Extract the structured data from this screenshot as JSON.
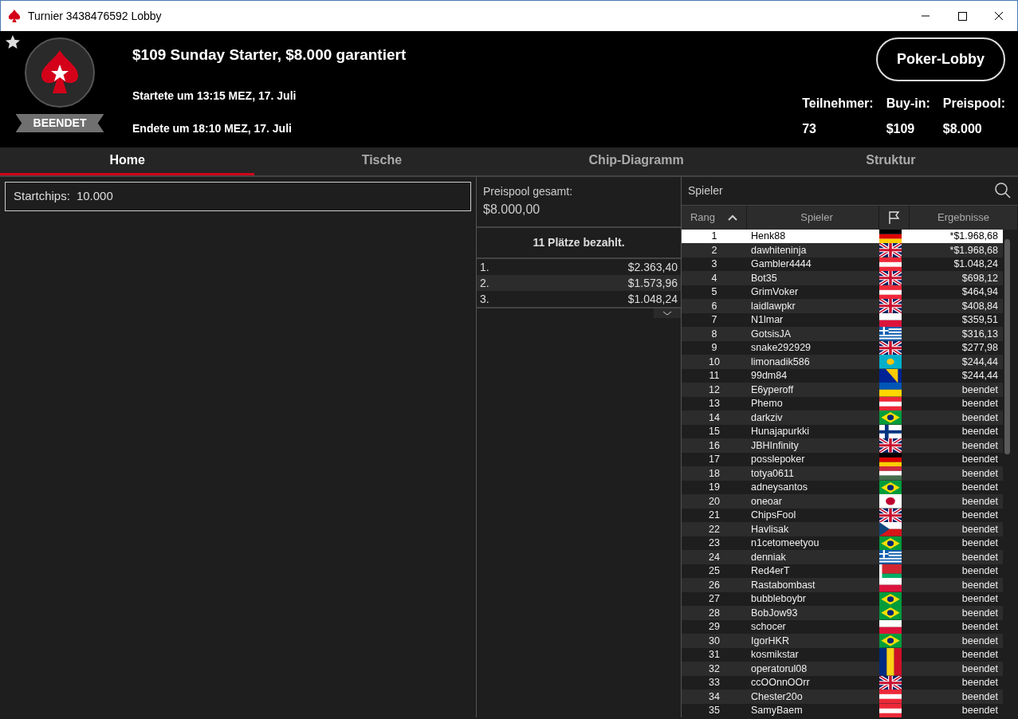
{
  "window": {
    "title": "Turnier 3438476592 Lobby"
  },
  "header": {
    "badge": "BEENDET",
    "title": "$109 Sunday Starter, $8.000 garantiert",
    "started": "Startete um 13:15 MEZ, 17. Juli",
    "ended": "Endete um 18:10 MEZ, 17. Juli",
    "lobby_button": "Poker-Lobby",
    "stats": [
      {
        "label": "Teilnehmer:",
        "value": "73"
      },
      {
        "label": "Buy-in:",
        "value": "$109"
      },
      {
        "label": "Preispool:",
        "value": "$8.000"
      }
    ]
  },
  "tabs": [
    {
      "label": "Home",
      "selected": true
    },
    {
      "label": "Tische",
      "selected": false
    },
    {
      "label": "Chip-Diagramm",
      "selected": false
    },
    {
      "label": "Struktur",
      "selected": false
    }
  ],
  "info": {
    "startchips_label": "Startchips:",
    "startchips": "10.000"
  },
  "prizes": {
    "pool_label": "Preispool gesamt:",
    "pool": "$8.000,00",
    "paid": "11 Plätze bezahlt.",
    "rows": [
      {
        "place": "1.",
        "amount": "$2.363,40"
      },
      {
        "place": "2.",
        "amount": "$1.573,96"
      },
      {
        "place": "3.",
        "amount": "$1.048,24"
      }
    ]
  },
  "players": {
    "search_label": "Spieler",
    "columns": [
      "Rang",
      "Spieler",
      "Ergebnisse"
    ],
    "rows": [
      {
        "rank": "1",
        "name": "Henk88",
        "kind": "de",
        "result": "*$1.968,68",
        "selected": true
      },
      {
        "rank": "2",
        "name": "dawhiteninja",
        "kind": "gb",
        "result": "*$1.968,68",
        "selected": false
      },
      {
        "rank": "3",
        "name": "Gambler4444",
        "kind": "at",
        "result": "$1.048,24",
        "selected": false
      },
      {
        "rank": "4",
        "name": "Bot35",
        "kind": "gb",
        "result": "$698,12",
        "selected": false
      },
      {
        "rank": "5",
        "name": "GrimVoker",
        "kind": "at",
        "result": "$464,94",
        "selected": false
      },
      {
        "rank": "6",
        "name": "laidlawpkr",
        "kind": "gb",
        "result": "$408,84",
        "selected": false
      },
      {
        "rank": "7",
        "name": "N1lmar",
        "kind": "pl",
        "result": "$359,51",
        "selected": false
      },
      {
        "rank": "8",
        "name": "GotsisJA",
        "kind": "gr",
        "result": "$316,13",
        "selected": false
      },
      {
        "rank": "9",
        "name": "snake292929",
        "kind": "gb",
        "result": "$277,98",
        "selected": false
      },
      {
        "rank": "10",
        "name": "limonadik586",
        "kind": "kz",
        "result": "$244,44",
        "selected": false
      },
      {
        "rank": "11",
        "name": "99dm84",
        "kind": "ba",
        "result": "$244,44",
        "selected": false
      },
      {
        "rank": "12",
        "name": "E6yperoff",
        "kind": "ua",
        "result": "beendet",
        "selected": false
      },
      {
        "rank": "13",
        "name": "Phemo",
        "kind": "at",
        "result": "beendet",
        "selected": false
      },
      {
        "rank": "14",
        "name": "darkziv",
        "kind": "br",
        "result": "beendet",
        "selected": false
      },
      {
        "rank": "15",
        "name": "Hunajapurkki",
        "kind": "fi",
        "result": "beendet",
        "selected": false
      },
      {
        "rank": "16",
        "name": "JBHInfinity",
        "kind": "gb",
        "result": "beendet",
        "selected": false
      },
      {
        "rank": "17",
        "name": "posslepoker",
        "kind": "de",
        "result": "beendet",
        "selected": false
      },
      {
        "rank": "18",
        "name": "totya0611",
        "kind": "hu",
        "result": "beendet",
        "selected": false
      },
      {
        "rank": "19",
        "name": "adneysantos",
        "kind": "br",
        "result": "beendet",
        "selected": false
      },
      {
        "rank": "20",
        "name": "oneoar",
        "kind": "jp",
        "result": "beendet",
        "selected": false
      },
      {
        "rank": "21",
        "name": "ChipsFool",
        "kind": "gb",
        "result": "beendet",
        "selected": false
      },
      {
        "rank": "22",
        "name": "Havlisak",
        "kind": "cz",
        "result": "beendet",
        "selected": false
      },
      {
        "rank": "23",
        "name": "n1cetomeetyou",
        "kind": "br",
        "result": "beendet",
        "selected": false
      },
      {
        "rank": "24",
        "name": "denniak",
        "kind": "gr",
        "result": "beendet",
        "selected": false
      },
      {
        "rank": "25",
        "name": "Red4erT",
        "kind": "by",
        "result": "beendet",
        "selected": false
      },
      {
        "rank": "26",
        "name": "Rastabombast",
        "kind": "pl",
        "result": "beendet",
        "selected": false
      },
      {
        "rank": "27",
        "name": "bubbleboybr",
        "kind": "br",
        "result": "beendet",
        "selected": false
      },
      {
        "rank": "28",
        "name": "BobJow93",
        "kind": "br",
        "result": "beendet",
        "selected": false
      },
      {
        "rank": "29",
        "name": "schocer",
        "kind": "pl",
        "result": "beendet",
        "selected": false
      },
      {
        "rank": "30",
        "name": "IgorHKR",
        "kind": "br",
        "result": "beendet",
        "selected": false
      },
      {
        "rank": "31",
        "name": "kosmikstar",
        "kind": "ro",
        "result": "beendet",
        "selected": false
      },
      {
        "rank": "32",
        "name": "operatorul08",
        "kind": "ro",
        "result": "beendet",
        "selected": false
      },
      {
        "rank": "33",
        "name": "ccOOnnOOrr",
        "kind": "gb",
        "result": "beendet",
        "selected": false
      },
      {
        "rank": "34",
        "name": "Chester20o",
        "kind": "at",
        "result": "beendet",
        "selected": false
      },
      {
        "rank": "35",
        "name": "SamyBaem",
        "kind": "at",
        "result": "beendet",
        "selected": false
      }
    ]
  }
}
